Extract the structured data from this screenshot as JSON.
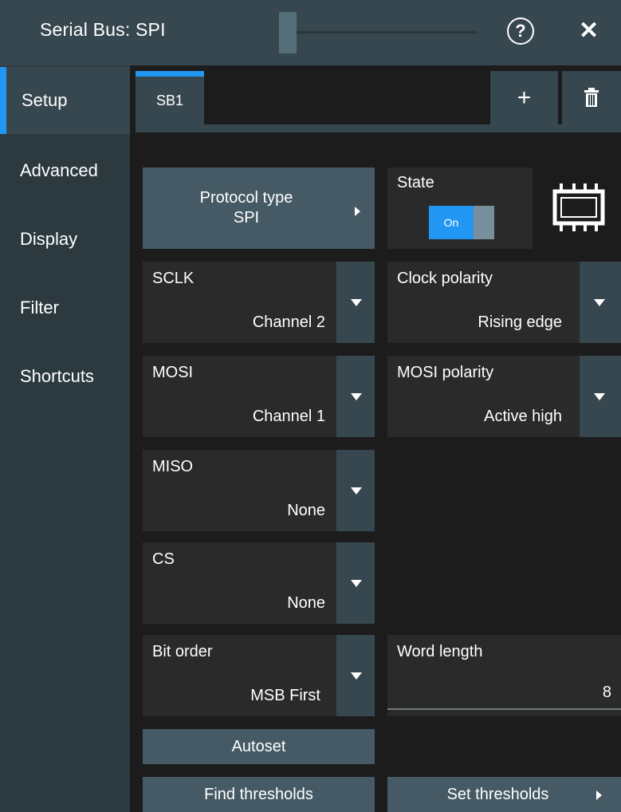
{
  "window": {
    "title": "Serial Bus: SPI",
    "help_glyph": "?",
    "close_glyph": "✕"
  },
  "sidebar": {
    "items": [
      {
        "label": "Setup",
        "active": true
      },
      {
        "label": "Advanced",
        "active": false
      },
      {
        "label": "Display",
        "active": false
      },
      {
        "label": "Filter",
        "active": false
      },
      {
        "label": "Shortcuts",
        "active": false
      }
    ]
  },
  "tabs": {
    "items": [
      {
        "label": "SB1",
        "active": true
      }
    ],
    "add_glyph": "+",
    "delete_icon": "trash-icon"
  },
  "setup": {
    "protocol": {
      "label": "Protocol type",
      "value": "SPI"
    },
    "state": {
      "label": "State",
      "value": "On"
    },
    "sclk": {
      "label": "SCLK",
      "value": "Channel 2"
    },
    "clock_polarity": {
      "label": "Clock polarity",
      "value": "Rising edge"
    },
    "mosi": {
      "label": "MOSI",
      "value": "Channel 1"
    },
    "mosi_polarity": {
      "label": "MOSI polarity",
      "value": "Active high"
    },
    "miso": {
      "label": "MISO",
      "value": "None"
    },
    "cs": {
      "label": "CS",
      "value": "None"
    },
    "bit_order": {
      "label": "Bit order",
      "value": "MSB First"
    },
    "word_length": {
      "label": "Word length",
      "value": "8"
    },
    "autoset_label": "Autoset",
    "find_thresholds_label": "Find thresholds",
    "set_thresholds_label": "Set thresholds"
  },
  "colors": {
    "accent": "#2196f3",
    "panel": "#37474f",
    "button": "#455a64",
    "field": "#2a2a2a",
    "background": "#1c1c1c"
  }
}
